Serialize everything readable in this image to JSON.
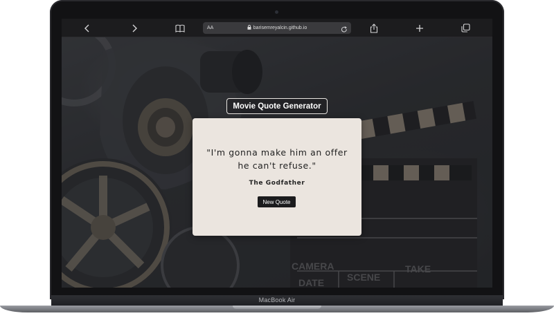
{
  "device": {
    "brand_label": "MacBook Air"
  },
  "browser": {
    "reader_label": "AA",
    "url": "barisemreyalcin.github.io",
    "icons": [
      "back-icon",
      "forward-icon",
      "bookmarks-icon",
      "lock-icon",
      "reload-icon",
      "share-icon",
      "new-tab-icon",
      "tabs-icon"
    ]
  },
  "app": {
    "title_button": "Movie Quote Generator",
    "quote": "\"I'm gonna make him an offer he can't refuse.\"",
    "movie": "The Godfather",
    "new_quote_button": "New Quote"
  },
  "background": {
    "clapperboard_labels": [
      "CAMERA",
      "DATE",
      "SCENE",
      "TAKE"
    ]
  },
  "colors": {
    "card": "#ebe5df",
    "button": "#1b1b1d",
    "toolbar": "#1c1c1e",
    "page_bg": "#2c2e32"
  }
}
